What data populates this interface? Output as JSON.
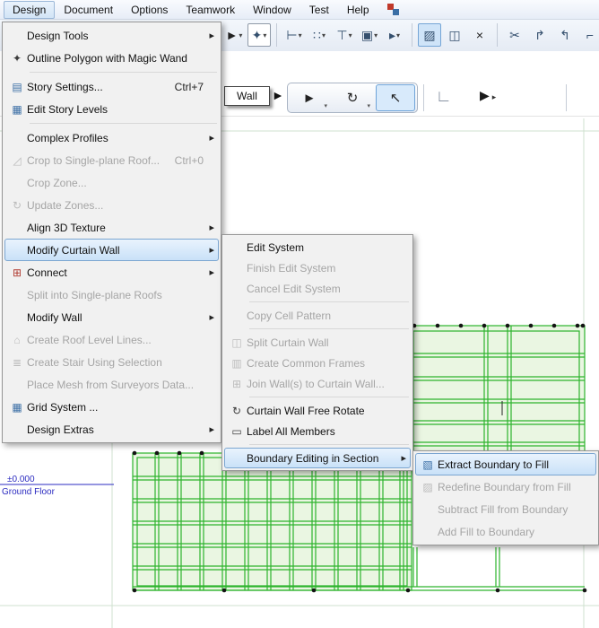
{
  "menubar": {
    "items": [
      "Design",
      "Document",
      "Options",
      "Teamwork",
      "Window",
      "Test",
      "Help"
    ]
  },
  "design_menu": {
    "items": [
      {
        "label": "Design Tools",
        "submenu": true
      },
      {
        "label": "Outline Polygon with Magic Wand",
        "icon": "magic-wand",
        "glyph": "✦"
      },
      {
        "label": "Story Settings...",
        "shortcut": "Ctrl+7",
        "icon": "story-settings",
        "glyph": "▤"
      },
      {
        "label": "Edit Story Levels",
        "icon": "edit-story-levels",
        "glyph": "▦"
      },
      {
        "label": "Complex Profiles",
        "submenu": true
      },
      {
        "label": "Crop to Single-plane Roof...",
        "shortcut": "Ctrl+0",
        "disabled": true,
        "icon": "crop-roof",
        "glyph": "◿"
      },
      {
        "label": "Crop Zone...",
        "disabled": true
      },
      {
        "label": "Update Zones...",
        "disabled": true,
        "icon": "update-zones",
        "glyph": "↻"
      },
      {
        "label": "Align 3D Texture",
        "submenu": true
      },
      {
        "label": "Modify Curtain Wall",
        "submenu": true,
        "highlighted": true
      },
      {
        "label": "Connect",
        "submenu": true,
        "icon": "connect",
        "glyph": "⊞"
      },
      {
        "label": "Split into Single-plane Roofs",
        "disabled": true
      },
      {
        "label": "Modify Wall",
        "submenu": true
      },
      {
        "label": "Create Roof Level Lines...",
        "disabled": true,
        "icon": "roof-level-lines",
        "glyph": "⌂"
      },
      {
        "label": "Create Stair Using Selection",
        "disabled": true,
        "icon": "stair",
        "glyph": "≣"
      },
      {
        "label": "Place Mesh from Surveyors Data...",
        "disabled": true
      },
      {
        "label": "Grid System ...",
        "icon": "grid-system",
        "glyph": "▦"
      },
      {
        "label": "Design Extras",
        "submenu": true
      }
    ]
  },
  "cw_submenu": {
    "items": [
      {
        "label": "Edit System"
      },
      {
        "label": "Finish Edit System",
        "disabled": true
      },
      {
        "label": "Cancel Edit System",
        "disabled": true
      },
      {
        "label": "Copy Cell Pattern",
        "disabled": true
      },
      {
        "label": "Split Curtain Wall",
        "disabled": true,
        "icon": "split-curtain-wall",
        "glyph": "◫"
      },
      {
        "label": "Create Common Frames",
        "disabled": true,
        "icon": "common-frames",
        "glyph": "▥"
      },
      {
        "label": "Join Wall(s) to Curtain Wall...",
        "disabled": true,
        "icon": "join-wall",
        "glyph": "⊞"
      },
      {
        "label": "Curtain Wall Free Rotate",
        "icon": "free-rotate",
        "glyph": "↻"
      },
      {
        "label": "Label All Members",
        "icon": "label-members",
        "glyph": "▭"
      },
      {
        "label": "Boundary Editing in Section",
        "submenu": true,
        "highlighted": true
      }
    ]
  },
  "boundary_submenu": {
    "items": [
      {
        "label": "Extract Boundary to Fill",
        "highlighted": true,
        "icon": "extract-boundary",
        "glyph": "▧"
      },
      {
        "label": "Redefine Boundary from Fill",
        "disabled": true,
        "icon": "redefine-boundary",
        "glyph": "▨"
      },
      {
        "label": "Subtract Fill from Boundary",
        "disabled": true
      },
      {
        "label": "Add Fill to Boundary",
        "disabled": true
      }
    ]
  },
  "toolbar1": {
    "buttons": [
      {
        "name": "select-tool",
        "glyph": "►"
      },
      {
        "name": "magic-wand-tool",
        "glyph": "✦"
      },
      {
        "name": "dimension-tool",
        "glyph": "⊢"
      },
      {
        "name": "pattern-tool",
        "glyph": "∷"
      },
      {
        "name": "marker-tool",
        "glyph": "⊤"
      },
      {
        "name": "layers-tool",
        "glyph": "▣"
      },
      {
        "name": "more-tool",
        "glyph": "▸"
      },
      {
        "name": "hatch-tool",
        "glyph": "▨"
      },
      {
        "name": "grid-text-tool",
        "glyph": "◫"
      },
      {
        "name": "close-tool",
        "glyph": "×"
      },
      {
        "name": "split-tool",
        "glyph": "✂"
      },
      {
        "name": "adjust-tool",
        "glyph": "↱"
      },
      {
        "name": "trim-tool",
        "glyph": "↰"
      },
      {
        "name": "corner-tool",
        "glyph": "⌐"
      },
      {
        "name": "angle-tool",
        "glyph": "∟"
      }
    ]
  },
  "toolbar2": {
    "wall_label": "Wall",
    "cursor_glyph": "►",
    "tools": [
      {
        "name": "arrow-tool",
        "glyph": "►"
      },
      {
        "name": "rotate-tool",
        "glyph": "↻"
      },
      {
        "name": "pick-tool",
        "glyph": "↖"
      }
    ],
    "angle_glyph": "∟",
    "play_glyph": "▶"
  },
  "canvas": {
    "elevation": "±0.000",
    "floor": "Ground Floor"
  },
  "colors": {
    "curtain_wall_line": "#2db42d",
    "curtain_wall_fill": "#eaf6e2",
    "level_line_blue": "#2b2bc0",
    "menu_highlight": "#c9e1f8",
    "menu_highlight_border": "#7ba6d1"
  }
}
